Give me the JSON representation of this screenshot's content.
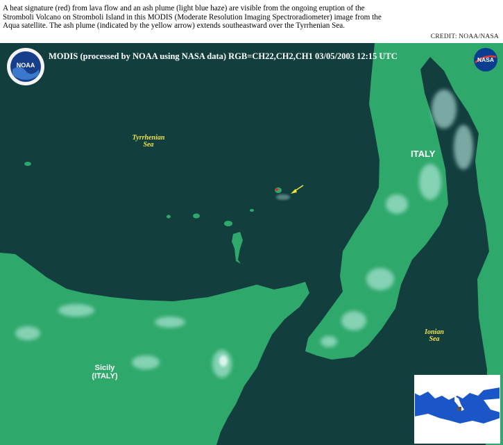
{
  "caption": "A heat signature (red) from lava flow and an ash plume (light blue haze) are visible from the ongoing eruption of the Stromboli Volcano on Stromboli Island in this MODIS (Moderate Resolution Imaging Spectroradiometer) image from the Aqua satellite.  The ash plume (indicated by the yellow arrow) extends southeastward over the Tyrrhenian Sea.",
  "credit": "CREDIT: NOAA/NASA",
  "header": "MODIS  (processed by NOAA using NASA data)  RGB=CH22,CH2,CH1  03/05/2003  12:15 UTC",
  "labels": {
    "tyrrhenian_line1": "Tyrrhenian",
    "tyrrhenian_line2": "Sea",
    "italy": "ITALY",
    "ionian_line1": "Ionian",
    "ionian_line2": "Sea",
    "sicily_line1": "Sicily",
    "sicily_line2": "(ITALY)"
  },
  "logos": {
    "noaa": "NOAA",
    "nasa": "NASA"
  },
  "colors": {
    "sea": "#123f3e",
    "land": "#2ea86b",
    "land_bright": "#3fc27c",
    "cloud": "#bfeee5",
    "lava": "#e0282a",
    "plume": "#8fb7ad",
    "arrow": "#f4e33a",
    "label_yellow": "#f2e24a",
    "inset_sea": "#1a56c8",
    "inset_land": "#ffffff"
  }
}
